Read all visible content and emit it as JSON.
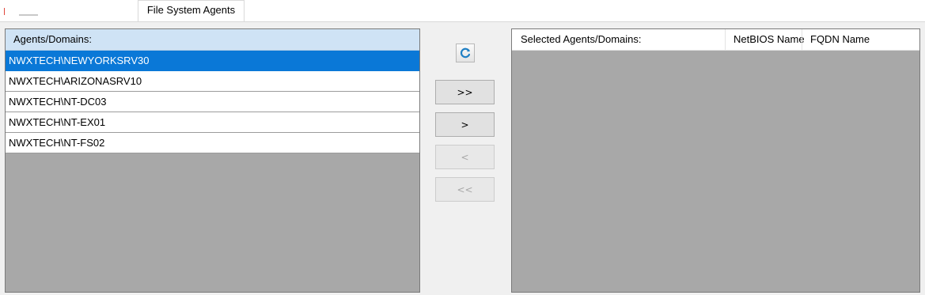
{
  "tabs": {
    "active_label": "File System Agents"
  },
  "left_list": {
    "header": "Agents/Domains:",
    "items": [
      {
        "label": "NWXTECH\\NEWYORKSRV30",
        "selected": true
      },
      {
        "label": "NWXTECH\\ARIZONASRV10",
        "selected": false
      },
      {
        "label": "NWXTECH\\NT-DC03",
        "selected": false
      },
      {
        "label": "NWXTECH\\NT-EX01",
        "selected": false
      },
      {
        "label": "NWXTECH\\NT-FS02",
        "selected": false
      }
    ]
  },
  "buttons": {
    "refresh_icon": "refresh-icon",
    "add_all_label": ">>",
    "add_label": ">",
    "remove_label": "<",
    "remove_all_label": "<<"
  },
  "right_list": {
    "columns": [
      "Selected Agents/Domains:",
      "NetBIOS Name",
      "FQDN Name"
    ]
  },
  "colors": {
    "selection": "#0a78d7",
    "header_bg": "#cfe3f5",
    "empty_area": "#a8a8a8"
  }
}
